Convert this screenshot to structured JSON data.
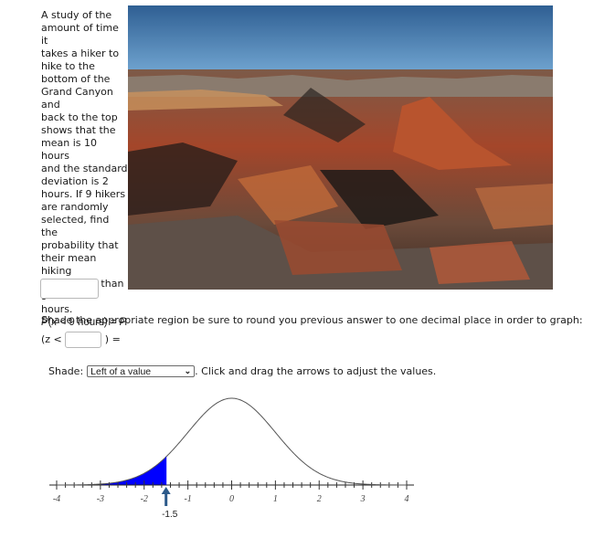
{
  "question": {
    "text": "A study of the amount of time it takes a hiker to hike to the bottom of the Grand Canyon and back to the top shows that the mean is 10 hours and the standard deviation is 2 hours. If 9 hikers are randomly selected, find the probability that their mean hiking time is less than 9 hours.",
    "lines": [
      "A study of the",
      "amount of time it",
      "takes a hiker to",
      "hike to the",
      "bottom of the",
      "Grand Canyon and",
      "back to the top",
      "shows that the",
      "mean is 10 hours",
      "and the standard",
      "deviation is 2",
      "hours. If 9 hikers",
      "are randomly",
      "selected, find the",
      "probability that",
      "their mean hiking",
      "time is less than 9",
      "hours."
    ],
    "prob_prefix": "P",
    "prob_var": "x",
    "prob_middle": " < 9 hours) = ",
    "prob_open": "(",
    "prob_suffix": "P",
    "z_prefix": "(z <",
    "z_suffix": ") =",
    "z_input_value": "",
    "answer_input_value": ""
  },
  "image": {
    "alt": "Grand Canyon landscape photo",
    "colors": {
      "sky_top": "#2f5f93",
      "sky_bottom": "#6fa3cf",
      "rock_red": "#a4462a",
      "rock_dark": "#3a2a22",
      "rock_light": "#c9925c"
    }
  },
  "instruction": "Shade the appropriate region be sure to round you previous answer to one decimal place in order to graph:",
  "shade": {
    "label": "Shade:",
    "selected": "Left of a value",
    "after_text": ". Click and drag the arrows to adjust the values."
  },
  "chart_data": {
    "type": "area",
    "title": "",
    "xlabel": "",
    "ylabel": "",
    "distribution": "standard normal",
    "mean": 0,
    "sd": 1,
    "xlim": [
      -4,
      4
    ],
    "tick_labels": [
      "-4",
      "-3",
      "-2",
      "-1",
      "0",
      "1",
      "2",
      "3",
      "4"
    ],
    "minor_ticks_per_unit": 5,
    "shade_region": "left",
    "shade_upper": -1.5,
    "arrow_value_label": "-1.5",
    "shade_color": "#0000ff",
    "curve_color": "#555555",
    "arrow_color": "#2c5a8a",
    "grid": false
  }
}
